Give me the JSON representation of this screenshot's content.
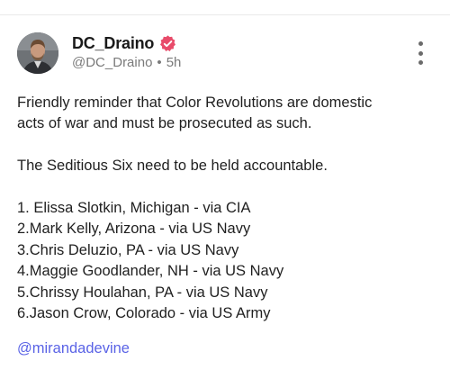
{
  "post": {
    "author": {
      "display_name": "DC_Draino",
      "handle": "@DC_Draino",
      "verified": true,
      "verified_color": "#e84b6a",
      "avatar_icon": "user-avatar-photo"
    },
    "time": "5h",
    "separator": "•",
    "menu_icon": "more-vertical-icon",
    "text": {
      "para1_line1": "Friendly reminder that Color Revolutions are domestic",
      "para1_line2": "acts of war and must be prosecuted as such.",
      "para2": "The Seditious Six need to be held accountable.",
      "list": [
        "1. Elissa Slotkin, Michigan - via CIA",
        "2.Mark Kelly, Arizona - via US Navy",
        "3.Chris Deluzio, PA - via US Navy",
        "4.Maggie Goodlander, NH - via US Navy",
        "5.Chrissy Houlahan, PA - via US Navy",
        "6.Jason Crow, Colorado - via US Army"
      ]
    },
    "mention": "@mirandadevine",
    "mention_color": "#5a63e6"
  }
}
